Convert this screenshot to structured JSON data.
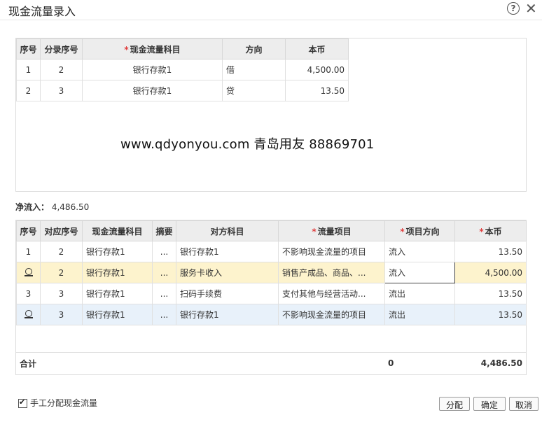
{
  "window": {
    "title": "现金流量录入"
  },
  "top_table": {
    "headers": {
      "seq": "序号",
      "entry_seq": "分录序号",
      "subject": "现金流量科目",
      "direction": "方向",
      "amount": "本币"
    },
    "rows": [
      {
        "seq": "1",
        "entry_seq": "2",
        "subject": "银行存款1",
        "direction": "借",
        "amount": "4,500.00"
      },
      {
        "seq": "2",
        "entry_seq": "3",
        "subject": "银行存款1",
        "direction": "贷",
        "amount": "13.50"
      }
    ]
  },
  "watermark": "www.qdyonyou.com  青岛用友 88869701",
  "net_inflow": {
    "label": "净流入：",
    "value": "4,486.50"
  },
  "bottom_table": {
    "headers": {
      "seq": "序号",
      "corr_seq": "对应序号",
      "subject": "现金流量科目",
      "summary": "摘要",
      "counter": "对方科目",
      "flow_item": "流量项目",
      "item_dir": "项目方向",
      "amount": "本币"
    },
    "rows": [
      {
        "seq": "1",
        "corr_seq": "2",
        "subject": "银行存款1",
        "summary": "...",
        "counter": "银行存款1",
        "flow_item": "不影响现金流量的项目",
        "item_dir": "流入",
        "amount": "13.50"
      },
      {
        "seq": "",
        "corr_seq": "2",
        "subject": "银行存款1",
        "summary": "...",
        "counter": "服务卡收入",
        "flow_item": "销售产成品、商品、...",
        "item_dir": "流入",
        "amount": "4,500.00"
      },
      {
        "seq": "3",
        "corr_seq": "3",
        "subject": "银行存款1",
        "summary": "...",
        "counter": "扫码手续费",
        "flow_item": "支付其他与经营活动...",
        "item_dir": "流出",
        "amount": "13.50"
      },
      {
        "seq": "",
        "corr_seq": "3",
        "subject": "银行存款1",
        "summary": "...",
        "counter": "银行存款1",
        "flow_item": "不影响现金流量的项目",
        "item_dir": "流出",
        "amount": "13.50"
      }
    ],
    "total": {
      "label": "合计",
      "count": "0",
      "amount": "4,486.50"
    }
  },
  "footer": {
    "manual_alloc_label": "手工分配现金流量",
    "manual_alloc_checked": true,
    "buttons": {
      "allocate": "分配",
      "confirm": "确定",
      "cancel": "取消"
    }
  },
  "icons": {
    "help": "help-circle-icon",
    "close": "close-icon",
    "row_marker": "row-settings-icon"
  }
}
